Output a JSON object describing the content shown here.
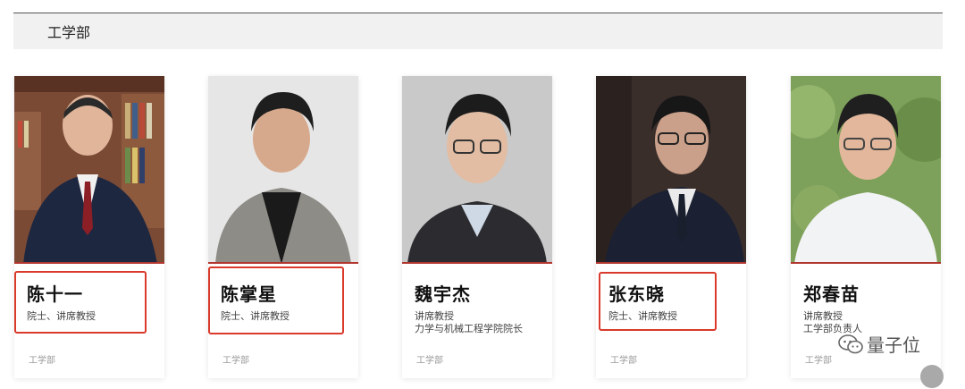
{
  "section": {
    "title": "工学部"
  },
  "people": [
    {
      "name": "陈十一",
      "title_lines": [
        "院士、讲席教授"
      ],
      "dept": "工学部"
    },
    {
      "name": "陈掌星",
      "title_lines": [
        "院士、讲席教授"
      ],
      "dept": "工学部"
    },
    {
      "name": "魏宇杰",
      "title_lines": [
        "讲席教授",
        "力学与机械工程学院院长"
      ],
      "dept": "工学部"
    },
    {
      "name": "张东晓",
      "title_lines": [
        "院士、讲席教授"
      ],
      "dept": "工学部"
    },
    {
      "name": "郑春苗",
      "title_lines": [
        "讲席教授",
        "工学部负责人"
      ],
      "dept": "工学部"
    }
  ],
  "watermark": {
    "text": "量子位",
    "icon": "wechat-icon"
  },
  "colors": {
    "accent": "#b2362f",
    "highlight": "#d93a2b",
    "section_bg": "#f1f1f1"
  }
}
